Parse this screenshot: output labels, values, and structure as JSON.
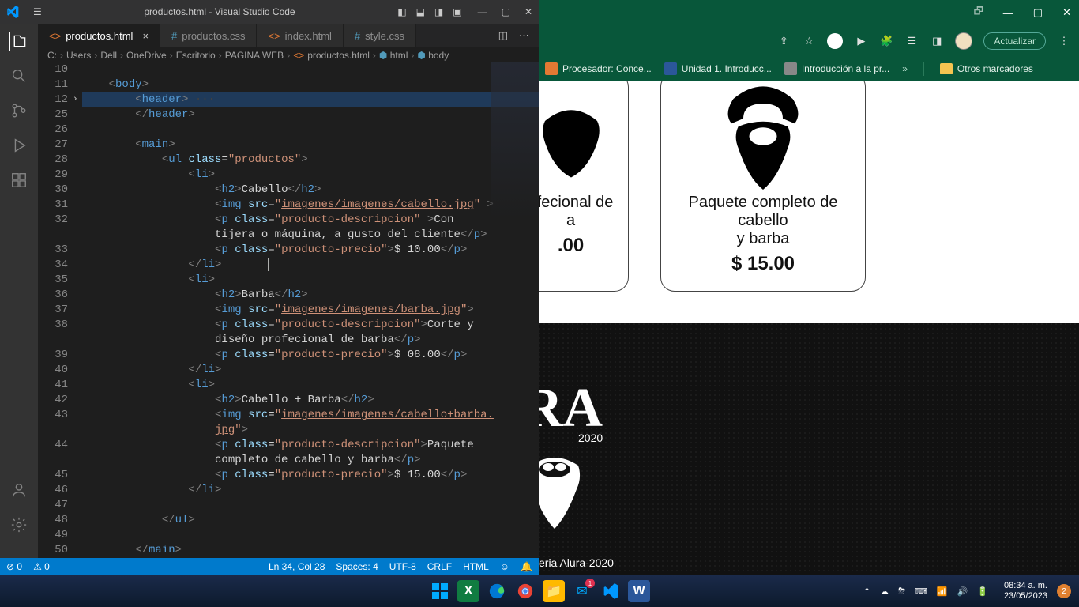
{
  "vscode": {
    "title": "productos.html - Visual Studio Code",
    "tabs": [
      {
        "label": "productos.html",
        "active": true,
        "kind": "html"
      },
      {
        "label": "productos.css",
        "active": false,
        "kind": "css"
      },
      {
        "label": "index.html",
        "active": false,
        "kind": "html"
      },
      {
        "label": "style.css",
        "active": false,
        "kind": "css"
      }
    ],
    "breadcrumb": [
      "C:",
      "Users",
      "Dell",
      "OneDrive",
      "Escritorio",
      "PAGINA WEB",
      "productos.html",
      "html",
      "body"
    ],
    "code_lines": [
      {
        "n": 10,
        "html": ""
      },
      {
        "n": 11,
        "html": "    <span class='c-br'>&lt;</span><span class='c-tag'>body</span><span class='c-br'>&gt;</span>"
      },
      {
        "n": 12,
        "html": "        <span class='c-br'>&lt;</span><span class='c-tag'>header</span><span class='c-br'>&gt;</span><span class='c-ws'> ···</span>",
        "hl": true,
        "fold": true
      },
      {
        "n": 25,
        "html": "        <span class='c-br'>&lt;/</span><span class='c-tag'>header</span><span class='c-br'>&gt;</span>"
      },
      {
        "n": 26,
        "html": ""
      },
      {
        "n": 27,
        "html": "        <span class='c-br'>&lt;</span><span class='c-tag'>main</span><span class='c-br'>&gt;</span>"
      },
      {
        "n": 28,
        "html": "            <span class='c-br'>&lt;</span><span class='c-tag'>ul</span> <span class='c-attr'>class</span>=<span class='c-str'>\"productos\"</span><span class='c-br'>&gt;</span>"
      },
      {
        "n": 29,
        "html": "                <span class='c-br'>&lt;</span><span class='c-tag'>li</span><span class='c-br'>&gt;</span>"
      },
      {
        "n": 30,
        "html": "                    <span class='c-br'>&lt;</span><span class='c-tag'>h2</span><span class='c-br'>&gt;</span>Cabello<span class='c-br'>&lt;/</span><span class='c-tag'>h2</span><span class='c-br'>&gt;</span>"
      },
      {
        "n": 31,
        "html": "                    <span class='c-br'>&lt;</span><span class='c-tag'>img</span> <span class='c-attr'>src</span>=<span class='c-str'>\"</span><span class='c-link'>imagenes/imagenes/cabello.jpg</span><span class='c-str'>\"</span> <span class='c-br'>&gt;</span>"
      },
      {
        "n": 32,
        "html": "                    <span class='c-br'>&lt;</span><span class='c-tag'>p</span> <span class='c-attr'>class</span>=<span class='c-str'>\"producto-descripcion\"</span> <span class='c-br'>&gt;</span>Con"
      },
      {
        "n": "",
        "html": "                    tijera o máquina, a gusto del cliente<span class='c-br'>&lt;/</span><span class='c-tag'>p</span><span class='c-br'>&gt;</span>"
      },
      {
        "n": 33,
        "html": "                    <span class='c-br'>&lt;</span><span class='c-tag'>p</span> <span class='c-attr'>class</span>=<span class='c-str'>\"producto-precio\"</span><span class='c-br'>&gt;</span>$ 10.00<span class='c-br'>&lt;/</span><span class='c-tag'>p</span><span class='c-br'>&gt;</span>"
      },
      {
        "n": 34,
        "html": "                <span class='c-br'>&lt;/</span><span class='c-tag'>li</span><span class='c-br'>&gt;</span>       <span style='border-left:1px solid #aeafad;'>&nbsp;</span>"
      },
      {
        "n": 35,
        "html": "                <span class='c-br'>&lt;</span><span class='c-tag'>li</span><span class='c-br'>&gt;</span>"
      },
      {
        "n": 36,
        "html": "                    <span class='c-br'>&lt;</span><span class='c-tag'>h2</span><span class='c-br'>&gt;</span>Barba<span class='c-br'>&lt;/</span><span class='c-tag'>h2</span><span class='c-br'>&gt;</span>"
      },
      {
        "n": 37,
        "html": "                    <span class='c-br'>&lt;</span><span class='c-tag'>img</span> <span class='c-attr'>src</span>=<span class='c-str'>\"</span><span class='c-link'>imagenes/imagenes/barba.jpg</span><span class='c-str'>\"</span><span class='c-br'>&gt;</span>"
      },
      {
        "n": 38,
        "html": "                    <span class='c-br'>&lt;</span><span class='c-tag'>p</span> <span class='c-attr'>class</span>=<span class='c-str'>\"producto-descripcion\"</span><span class='c-br'>&gt;</span>Corte y"
      },
      {
        "n": "",
        "html": "                    diseño profecional de barba<span class='c-br'>&lt;/</span><span class='c-tag'>p</span><span class='c-br'>&gt;</span>"
      },
      {
        "n": 39,
        "html": "                    <span class='c-br'>&lt;</span><span class='c-tag'>p</span> <span class='c-attr'>class</span>=<span class='c-str'>\"producto-precio\"</span><span class='c-br'>&gt;</span>$ 08.00<span class='c-br'>&lt;/</span><span class='c-tag'>p</span><span class='c-br'>&gt;</span>"
      },
      {
        "n": 40,
        "html": "                <span class='c-br'>&lt;/</span><span class='c-tag'>li</span><span class='c-br'>&gt;</span>"
      },
      {
        "n": 41,
        "html": "                <span class='c-br'>&lt;</span><span class='c-tag'>li</span><span class='c-br'>&gt;</span>"
      },
      {
        "n": 42,
        "html": "                    <span class='c-br'>&lt;</span><span class='c-tag'>h2</span><span class='c-br'>&gt;</span>Cabello + Barba<span class='c-br'>&lt;/</span><span class='c-tag'>h2</span><span class='c-br'>&gt;</span>"
      },
      {
        "n": 43,
        "html": "                    <span class='c-br'>&lt;</span><span class='c-tag'>img</span> <span class='c-attr'>src</span>=<span class='c-str'>\"</span><span class='c-link'>imagenes/imagenes/cabello+barba.</span>"
      },
      {
        "n": "",
        "html": "                    <span class='c-link'>jpg</span><span class='c-str'>\"</span><span class='c-br'>&gt;</span>"
      },
      {
        "n": 44,
        "html": "                    <span class='c-br'>&lt;</span><span class='c-tag'>p</span> <span class='c-attr'>class</span>=<span class='c-str'>\"producto-descripcion\"</span><span class='c-br'>&gt;</span>Paquete"
      },
      {
        "n": "",
        "html": "                    completo de cabello y barba<span class='c-br'>&lt;/</span><span class='c-tag'>p</span><span class='c-br'>&gt;</span>"
      },
      {
        "n": 45,
        "html": "                    <span class='c-br'>&lt;</span><span class='c-tag'>p</span> <span class='c-attr'>class</span>=<span class='c-str'>\"producto-precio\"</span><span class='c-br'>&gt;</span>$ 15.00<span class='c-br'>&lt;/</span><span class='c-tag'>p</span><span class='c-br'>&gt;</span>"
      },
      {
        "n": 46,
        "html": "                <span class='c-br'>&lt;/</span><span class='c-tag'>li</span><span class='c-br'>&gt;</span>"
      },
      {
        "n": 47,
        "html": ""
      },
      {
        "n": 48,
        "html": "            <span class='c-br'>&lt;/</span><span class='c-tag'>ul</span><span class='c-br'>&gt;</span>"
      },
      {
        "n": 49,
        "html": ""
      },
      {
        "n": 50,
        "html": "        <span class='c-br'>&lt;/</span><span class='c-tag'>main</span><span class='c-br'>&gt;</span>"
      }
    ],
    "status": {
      "errors": "0",
      "warnings": "0",
      "cursor": "Ln 34, Col 28",
      "spaces": "Spaces: 4",
      "encoding": "UTF-8",
      "eol": "CRLF",
      "lang": "HTML"
    }
  },
  "browser": {
    "update_label": "Actualizar",
    "bookmarks": [
      {
        "label": "Procesador: Conce...",
        "icon": "orange"
      },
      {
        "label": "Unidad 1. Introducc...",
        "icon": "word"
      },
      {
        "label": "Introducción a la pr...",
        "icon": "gray"
      }
    ],
    "other_bookmarks": "Otros marcadores",
    "card_left": {
      "desc_line1": "ofecional de",
      "desc_line2": "a",
      "price": ".00"
    },
    "card_right": {
      "desc_line1": "Paquete completo de cabello",
      "desc_line2": "y barba",
      "price": "$ 15.00"
    },
    "footer_copy": "eria Alura-2020",
    "footer_year": "2020"
  },
  "taskbar": {
    "time": "08:34 a. m.",
    "date": "23/05/2023",
    "notif_count": "2"
  }
}
